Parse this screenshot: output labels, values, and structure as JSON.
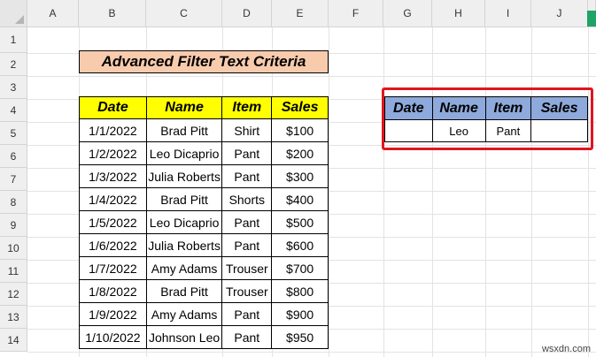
{
  "columns": [
    "A",
    "B",
    "C",
    "D",
    "E",
    "F",
    "G",
    "H",
    "I",
    "J"
  ],
  "rows": [
    "1",
    "2",
    "3",
    "4",
    "5",
    "6",
    "7",
    "8",
    "9",
    "10",
    "11",
    "12",
    "13",
    "14"
  ],
  "title": "Advanced Filter Text Criteria",
  "data_table": {
    "headers": [
      "Date",
      "Name",
      "Item",
      "Sales"
    ],
    "rows": [
      [
        "1/1/2022",
        "Brad Pitt",
        "Shirt",
        "$100"
      ],
      [
        "1/2/2022",
        "Leo Dicaprio",
        "Pant",
        "$200"
      ],
      [
        "1/3/2022",
        "Julia Roberts",
        "Pant",
        "$300"
      ],
      [
        "1/4/2022",
        "Brad Pitt",
        "Shorts",
        "$400"
      ],
      [
        "1/5/2022",
        "Leo Dicaprio",
        "Pant",
        "$500"
      ],
      [
        "1/6/2022",
        "Julia Roberts",
        "Pant",
        "$600"
      ],
      [
        "1/7/2022",
        "Amy Adams",
        "Trouser",
        "$700"
      ],
      [
        "1/8/2022",
        "Brad Pitt",
        "Trouser",
        "$800"
      ],
      [
        "1/9/2022",
        "Amy Adams",
        "Pant",
        "$900"
      ],
      [
        "1/10/2022",
        "Johnson Leo",
        "Pant",
        "$950"
      ]
    ]
  },
  "criteria_table": {
    "headers": [
      "Date",
      "Name",
      "Item",
      "Sales"
    ],
    "row": [
      "",
      "Leo",
      "Pant",
      ""
    ]
  },
  "watermark": "wsxdn.com",
  "colors": {
    "header_fill": "#ffff00",
    "criteria_header_fill": "#8ea9db",
    "title_fill": "#f8cbad",
    "highlight_border": "#e0161f"
  }
}
